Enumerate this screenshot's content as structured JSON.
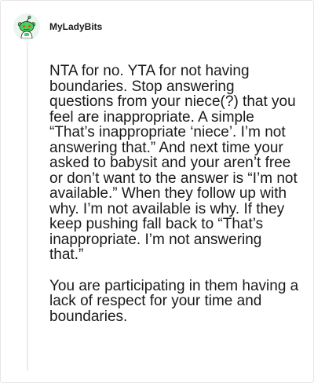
{
  "comment": {
    "username": "MyLadyBits",
    "avatar_icon": "snoo-avatar-icon",
    "paragraphs": [
      "NTA for no. YTA for not having boundaries. Stop answering questions from your niece(?) that you feel are inappropriate. A simple “That’s inappropriate ‘niece’. I’m not answering that.” And next time your asked to babysit and your aren’t free or don’t want to the answer is “I’m not available.” When they follow up with why. I’m not available is why. If they keep pushing fall back to “That’s inappropriate. I’m not answering that.”",
      "You are participating in them having a lack of respect for your time and boundaries."
    ]
  },
  "colors": {
    "text": "#1a1a1b",
    "border": "#e6e6e6",
    "thread_line": "#ededed",
    "avatar_bg": "#eaf5ee",
    "avatar_body": "#46d160"
  }
}
